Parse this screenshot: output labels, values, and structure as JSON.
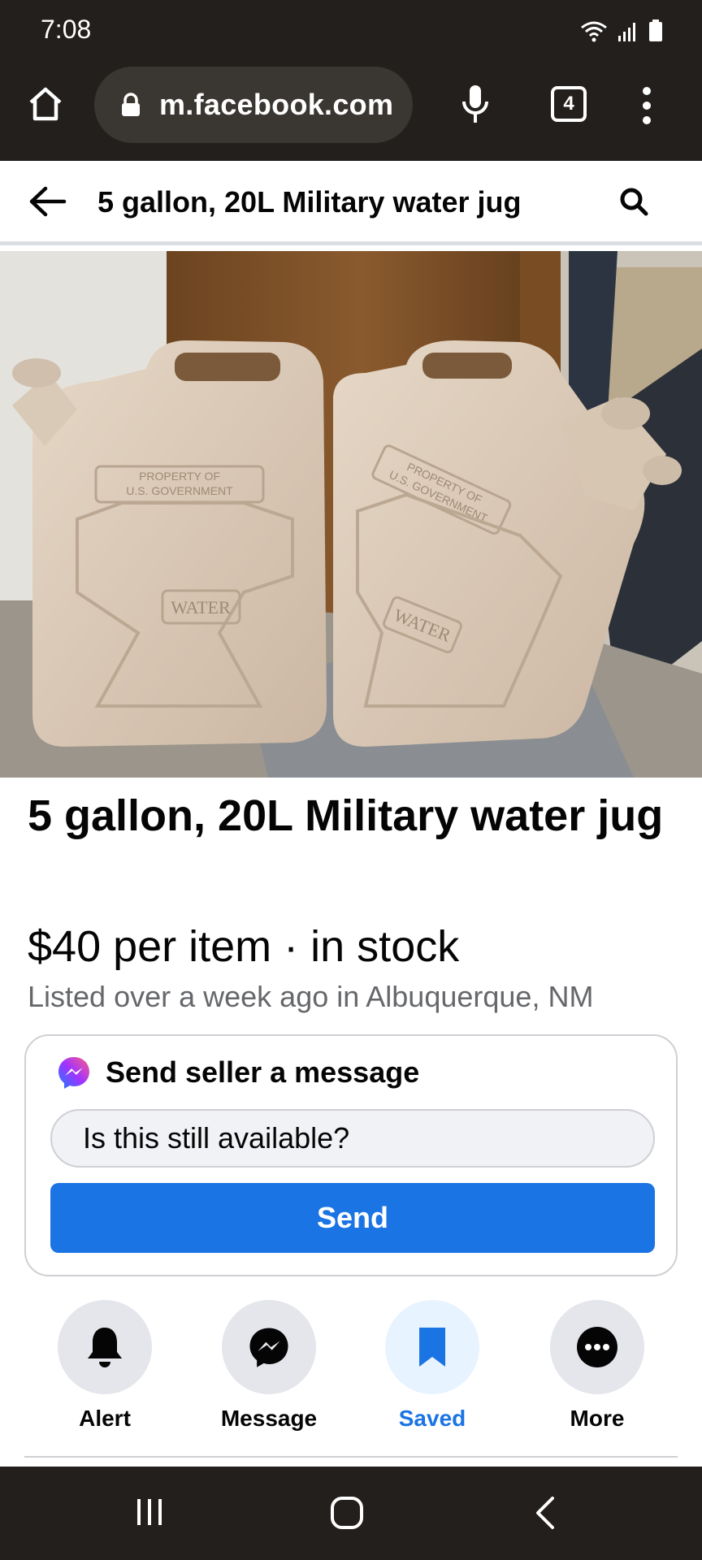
{
  "status_bar": {
    "time": "7:08"
  },
  "browser": {
    "url": "m.facebook.com",
    "tab_count": "4"
  },
  "header": {
    "title": "5 gallon, 20L Military water jug"
  },
  "photo": {
    "left_jug": {
      "stamp_line1": "PROPERTY OF",
      "stamp_line2": "U.S. GOVERNMENT",
      "label": "WATER"
    },
    "right_jug": {
      "stamp_line1": "PROPERTY OF",
      "stamp_line2": "U.S. GOVERNMENT",
      "label": "WATER"
    }
  },
  "listing": {
    "title": "5 gallon, 20L Military water jug",
    "price_line": "$40 per item · in stock",
    "listed_line": "Listed over a week ago in Albuquerque, NM"
  },
  "message_card": {
    "header": "Send seller a message",
    "input_value": "Is this still available?",
    "send_label": "Send"
  },
  "actions": [
    {
      "label": "Alert",
      "icon": "bell-icon"
    },
    {
      "label": "Message",
      "icon": "messenger-icon"
    },
    {
      "label": "Saved",
      "icon": "bookmark-icon",
      "active": true
    },
    {
      "label": "More",
      "icon": "more-icon"
    }
  ],
  "colors": {
    "facebook_blue": "#1b74e4",
    "chrome_dark": "#221f1c",
    "secondary_text": "#65676b"
  }
}
